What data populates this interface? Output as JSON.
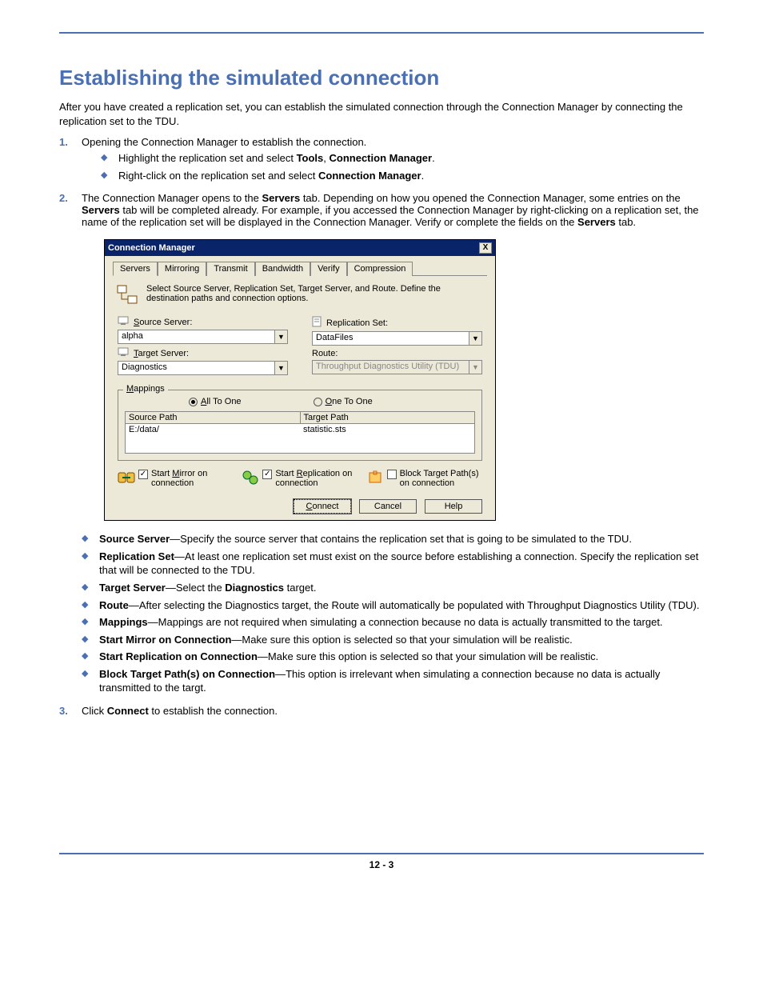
{
  "heading": "Establishing the simulated connection",
  "intro": "After you have created a replication set, you can establish the simulated connection through the Connection Manager by connecting the replication set to the TDU.",
  "step1_num": "1.",
  "step1_text": "Opening the Connection Manager to establish the connection.",
  "s1_bullets": {
    "b1_pre": "Highlight the replication set and select ",
    "b1_bold1": "Tools",
    "b1_mid": ", ",
    "b1_bold2": "Connection Manager",
    "b1_post": ".",
    "b2_pre": "Right-click on the replication set and select ",
    "b2_bold1": "Connection Manager",
    "b2_post": "."
  },
  "step2_num": "2.",
  "step2_pre": "The Connection Manager opens to the ",
  "step2_b1": "Servers",
  "step2_mid1": " tab. Depending on how you opened the Connection Manager, some entries on the ",
  "step2_b2": "Servers",
  "step2_mid2": " tab will be completed already. For example, if you accessed the Connection Manager by right-clicking on a replication set, the name of the replication set will be displayed in the Connection Manager. Verify or complete the fields on the ",
  "step2_b3": "Servers",
  "step2_post": " tab.",
  "dialog": {
    "title": "Connection Manager",
    "close": "X",
    "tabs": {
      "t1": "Servers",
      "t2": "Mirroring",
      "t3": "Transmit",
      "t4": "Bandwidth",
      "t5": "Verify",
      "t6": "Compression"
    },
    "desc": "Select Source Server, Replication Set, Target Server, and Route.  Define the destination paths and connection options.",
    "labels": {
      "source": "Source Server:",
      "target": "Target Server:",
      "repset": "Replication Set:",
      "route": "Route:"
    },
    "values": {
      "source": "alpha",
      "target": "Diagnostics",
      "repset": "DataFiles",
      "route": "Throughput Diagnostics Utility (TDU)"
    },
    "mappings": "Mappings",
    "radio_all": "All To One",
    "radio_one": "One To One",
    "col_src": "Source Path",
    "col_tgt": "Target Path",
    "row_src": "E:/data/",
    "row_tgt": "statistic.sts",
    "chk_mirror": "Start Mirror on connection",
    "chk_repl": "Start Replication on connection",
    "chk_block": "Block Target Path(s) on connection",
    "btn_connect": "Connect",
    "btn_cancel": "Cancel",
    "btn_help": "Help"
  },
  "defs": {
    "d1_t": "Source Server",
    "d1_b": "—Specify the source server that contains the replication set that is going to be simulated to the TDU.",
    "d2_t": "Replication Set",
    "d2_b": "—At least one replication set must exist on the source before establishing a connection. Specify the replication set that will be connected to the TDU.",
    "d3_t": "Target Server",
    "d3_b1": "—Select the ",
    "d3_bm": "Diagnostics",
    "d3_b2": " target.",
    "d4_t": "Route",
    "d4_b": "—After selecting the Diagnostics target, the Route will automatically be populated with Throughput Diagnostics Utility (TDU).",
    "d5_t": "Mappings",
    "d5_b": "—Mappings are not required when simulating a connection because no data is actually transmitted to the target.",
    "d6_t": "Start Mirror on Connection",
    "d6_b": "—Make sure this option is selected so that your simulation will be realistic.",
    "d7_t": "Start Replication on Connection",
    "d7_b": "—Make sure this option is selected so that your simulation will be realistic.",
    "d8_t": "Block Target Path(s) on Connection",
    "d8_b": "—This option is irrelevant when simulating a connection because no data is actually transmitted to the targt."
  },
  "step3_num": "3.",
  "step3_pre": "Click ",
  "step3_b": "Connect",
  "step3_post": " to establish the connection.",
  "pagenum": "12 - 3"
}
